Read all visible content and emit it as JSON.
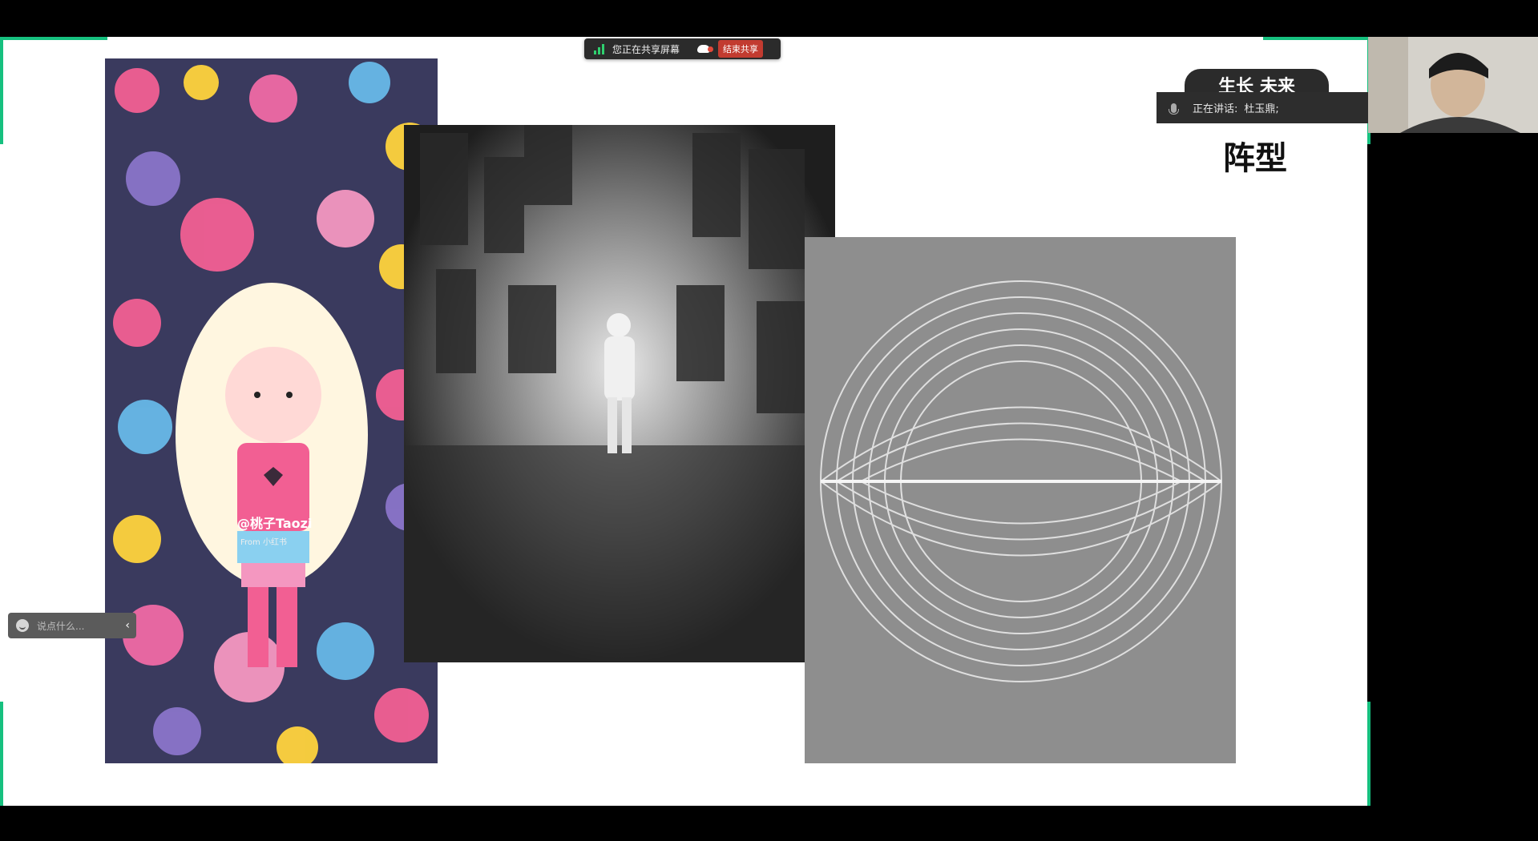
{
  "share_bar": {
    "status": "您正在共享屏幕",
    "stop_label": "结束共享"
  },
  "slide": {
    "heading": "阵型",
    "title_pill": "生长 未来",
    "doodle_watermark": "@桃子Taozi",
    "doodle_source": "From 小红书"
  },
  "speaking": {
    "label": "正在讲话:",
    "name": "杜玉鼎;"
  },
  "chat": {
    "placeholder": "说点什么..."
  },
  "colors": {
    "accent_green": "#16c07f",
    "stop_red": "#c23b30"
  },
  "icons": [
    "signal-icon",
    "cloud-icon",
    "mic-icon",
    "smile-icon",
    "chevron-left-icon"
  ]
}
